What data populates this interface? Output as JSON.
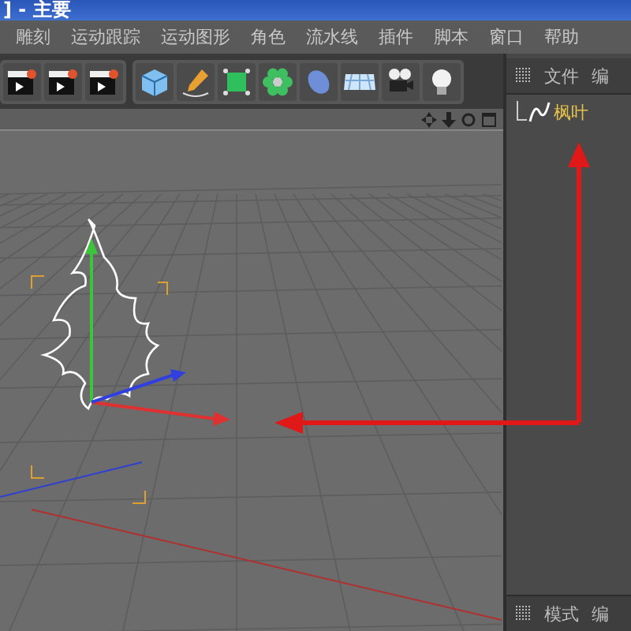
{
  "window": {
    "title": "] - 主要"
  },
  "menu": [
    "雕刻",
    "运动跟踪",
    "运动图形",
    "角色",
    "流水线",
    "插件",
    "脚本",
    "窗口",
    "帮助"
  ],
  "object_manager": {
    "tabs": [
      "文件",
      "编"
    ],
    "objects": [
      {
        "name": "枫叶"
      }
    ]
  },
  "attribute_manager": {
    "tabs": [
      "模式",
      "编"
    ]
  }
}
